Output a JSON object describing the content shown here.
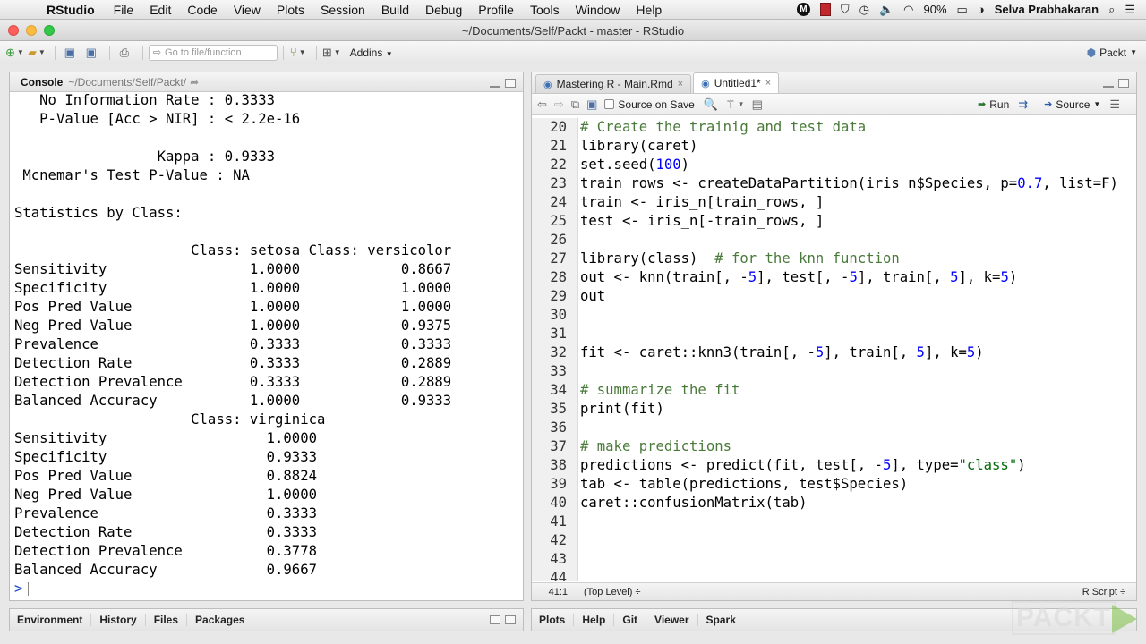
{
  "menubar": {
    "app_name": "RStudio",
    "items": [
      "File",
      "Edit",
      "Code",
      "View",
      "Plots",
      "Session",
      "Build",
      "Debug",
      "Profile",
      "Tools",
      "Window",
      "Help"
    ],
    "battery": "90%",
    "user": "Selva Prabhakaran"
  },
  "window": {
    "title": "~/Documents/Self/Packt - master - RStudio"
  },
  "toolbar": {
    "goto_placeholder": "Go to file/function",
    "addins_label": "Addins",
    "project_label": "Packt"
  },
  "console": {
    "title": "Console",
    "path": "~/Documents/Self/Packt/",
    "lines": [
      "   No Information Rate : 0.3333",
      "   P-Value [Acc > NIR] : < 2.2e-16",
      "",
      "                 Kappa : 0.9333",
      " Mcnemar's Test P-Value : NA",
      "",
      "Statistics by Class:",
      "",
      "                     Class: setosa Class: versicolor",
      "Sensitivity                 1.0000            0.8667",
      "Specificity                 1.0000            1.0000",
      "Pos Pred Value              1.0000            1.0000",
      "Neg Pred Value              1.0000            0.9375",
      "Prevalence                  0.3333            0.3333",
      "Detection Rate              0.3333            0.2889",
      "Detection Prevalence        0.3333            0.2889",
      "Balanced Accuracy           1.0000            0.9333",
      "                     Class: virginica",
      "Sensitivity                   1.0000",
      "Specificity                   0.9333",
      "Pos Pred Value                0.8824",
      "Neg Pred Value                1.0000",
      "Prevalence                    0.3333",
      "Detection Rate                0.3333",
      "Detection Prevalence          0.3778",
      "Balanced Accuracy             0.9667"
    ],
    "prompt": ">"
  },
  "editor": {
    "tabs": [
      {
        "label": "Mastering R - Main.Rmd",
        "active": false
      },
      {
        "label": "Untitled1*",
        "active": true
      }
    ],
    "source_on_save_label": "Source on Save",
    "run_label": "Run",
    "source_label": "Source",
    "lines": [
      {
        "n": "20",
        "t": "# Create the trainig and test data"
      },
      {
        "n": "21",
        "t": "library(caret)"
      },
      {
        "n": "22",
        "t": "set.seed(100)"
      },
      {
        "n": "23",
        "t": "train_rows <- createDataPartition(iris_n$Species, p=0.7, list=F)"
      },
      {
        "n": "24",
        "t": "train <- iris_n[train_rows, ]"
      },
      {
        "n": "25",
        "t": "test <- iris_n[-train_rows, ]"
      },
      {
        "n": "26",
        "t": ""
      },
      {
        "n": "27",
        "t": "library(class)  # for the knn function"
      },
      {
        "n": "28",
        "t": "out <- knn(train[, -5], test[, -5], train[, 5], k=5)"
      },
      {
        "n": "29",
        "t": "out"
      },
      {
        "n": "30",
        "t": ""
      },
      {
        "n": "31",
        "t": ""
      },
      {
        "n": "32",
        "t": "fit <- caret::knn3(train[, -5], train[, 5], k=5)"
      },
      {
        "n": "33",
        "t": ""
      },
      {
        "n": "34",
        "t": "# summarize the fit"
      },
      {
        "n": "35",
        "t": "print(fit)"
      },
      {
        "n": "36",
        "t": ""
      },
      {
        "n": "37",
        "t": "# make predictions"
      },
      {
        "n": "38",
        "t": "predictions <- predict(fit, test[, -5], type=\"class\")"
      },
      {
        "n": "39",
        "t": "tab <- table(predictions, test$Species)"
      },
      {
        "n": "40",
        "t": "caret::confusionMatrix(tab)"
      },
      {
        "n": "41",
        "t": ""
      },
      {
        "n": "42",
        "t": ""
      },
      {
        "n": "43",
        "t": ""
      },
      {
        "n": "44",
        "t": ""
      }
    ],
    "status": {
      "position": "41:1",
      "scope": "(Top Level) ÷",
      "file_type": "R Script ÷"
    }
  },
  "env_pane_tabs": [
    "Environment",
    "History",
    "Files",
    "Packages"
  ],
  "plots_pane_tabs": [
    "Plots",
    "Help",
    "Git",
    "Viewer",
    "Spark"
  ],
  "watermark": "PACKT"
}
